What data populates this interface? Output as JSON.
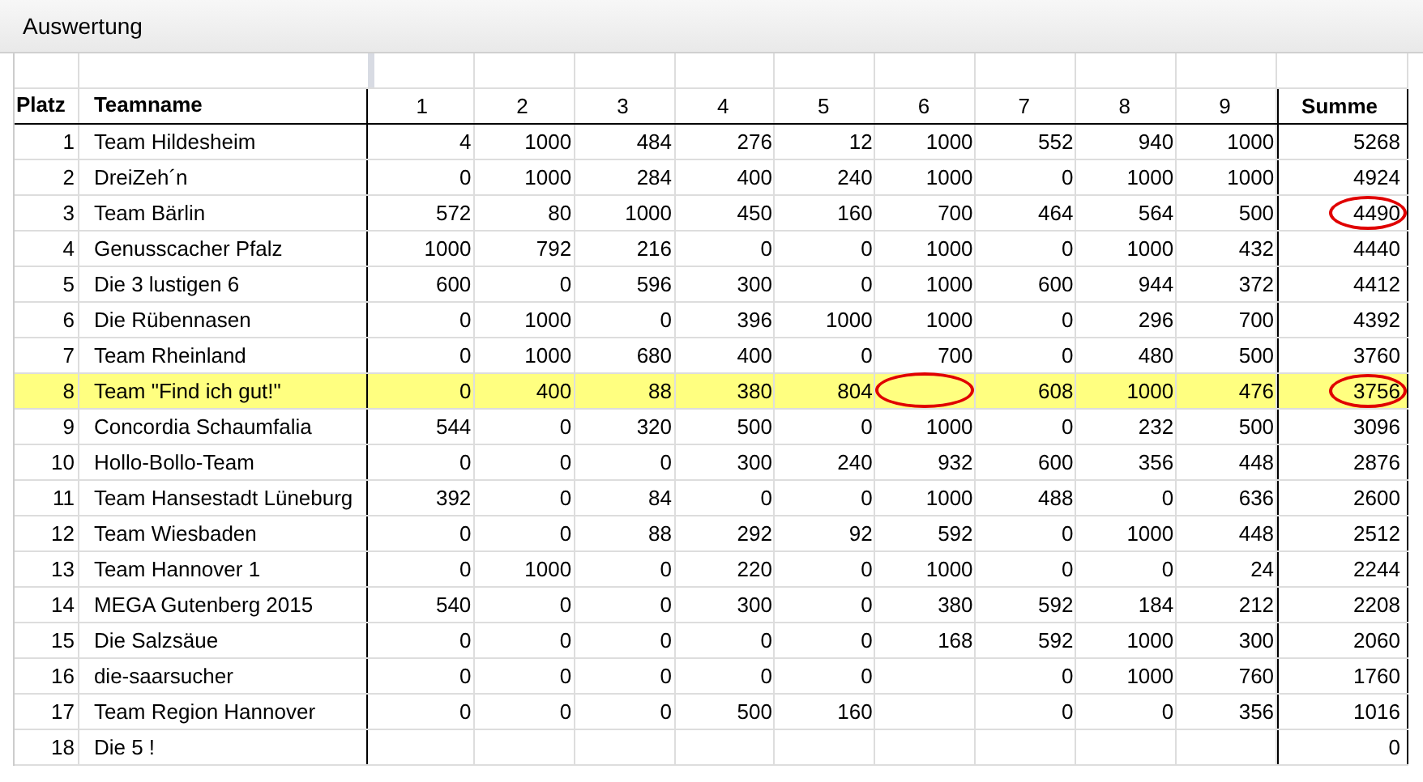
{
  "window": {
    "title": "Auswertung"
  },
  "table": {
    "columns": [
      "Platz",
      "Teamname",
      "1",
      "2",
      "3",
      "4",
      "5",
      "6",
      "7",
      "8",
      "9",
      "Summe"
    ],
    "rows": [
      {
        "rank": "1",
        "name": "Team Hildesheim",
        "highlighted": false,
        "scores": [
          {
            "value": "4",
            "circled": false
          },
          {
            "value": "1000",
            "circled": false
          },
          {
            "value": "484",
            "circled": false
          },
          {
            "value": "276",
            "circled": false
          },
          {
            "value": "12",
            "circled": false
          },
          {
            "value": "1000",
            "circled": false
          },
          {
            "value": "552",
            "circled": false
          },
          {
            "value": "940",
            "circled": false
          },
          {
            "value": "1000",
            "circled": false
          }
        ],
        "total": {
          "value": "5268",
          "circled": false
        }
      },
      {
        "rank": "2",
        "name": "DreiZeh´n",
        "highlighted": false,
        "scores": [
          {
            "value": "0",
            "circled": false
          },
          {
            "value": "1000",
            "circled": false
          },
          {
            "value": "284",
            "circled": false
          },
          {
            "value": "400",
            "circled": false
          },
          {
            "value": "240",
            "circled": false
          },
          {
            "value": "1000",
            "circled": false
          },
          {
            "value": "0",
            "circled": false
          },
          {
            "value": "1000",
            "circled": false
          },
          {
            "value": "1000",
            "circled": false
          }
        ],
        "total": {
          "value": "4924",
          "circled": false
        }
      },
      {
        "rank": "3",
        "name": "Team Bärlin",
        "highlighted": false,
        "scores": [
          {
            "value": "572",
            "circled": false
          },
          {
            "value": "80",
            "circled": false
          },
          {
            "value": "1000",
            "circled": false
          },
          {
            "value": "450",
            "circled": false
          },
          {
            "value": "160",
            "circled": false
          },
          {
            "value": "700",
            "circled": false
          },
          {
            "value": "464",
            "circled": false
          },
          {
            "value": "564",
            "circled": false
          },
          {
            "value": "500",
            "circled": false
          }
        ],
        "total": {
          "value": "4490",
          "circled": true
        }
      },
      {
        "rank": "4",
        "name": "Genusscacher Pfalz",
        "highlighted": false,
        "scores": [
          {
            "value": "1000",
            "circled": false
          },
          {
            "value": "792",
            "circled": false
          },
          {
            "value": "216",
            "circled": false
          },
          {
            "value": "0",
            "circled": false
          },
          {
            "value": "0",
            "circled": false
          },
          {
            "value": "1000",
            "circled": false
          },
          {
            "value": "0",
            "circled": false
          },
          {
            "value": "1000",
            "circled": false
          },
          {
            "value": "432",
            "circled": false
          }
        ],
        "total": {
          "value": "4440",
          "circled": false
        }
      },
      {
        "rank": "5",
        "name": "Die 3 lustigen 6",
        "highlighted": false,
        "scores": [
          {
            "value": "600",
            "circled": false
          },
          {
            "value": "0",
            "circled": false
          },
          {
            "value": "596",
            "circled": false
          },
          {
            "value": "300",
            "circled": false
          },
          {
            "value": "0",
            "circled": false
          },
          {
            "value": "1000",
            "circled": false
          },
          {
            "value": "600",
            "circled": false
          },
          {
            "value": "944",
            "circled": false
          },
          {
            "value": "372",
            "circled": false
          }
        ],
        "total": {
          "value": "4412",
          "circled": false
        }
      },
      {
        "rank": "6",
        "name": "Die Rübennasen",
        "highlighted": false,
        "scores": [
          {
            "value": "0",
            "circled": false
          },
          {
            "value": "1000",
            "circled": false
          },
          {
            "value": "0",
            "circled": false
          },
          {
            "value": "396",
            "circled": false
          },
          {
            "value": "1000",
            "circled": false
          },
          {
            "value": "1000",
            "circled": false
          },
          {
            "value": "0",
            "circled": false
          },
          {
            "value": "296",
            "circled": false
          },
          {
            "value": "700",
            "circled": false
          }
        ],
        "total": {
          "value": "4392",
          "circled": false
        }
      },
      {
        "rank": "7",
        "name": "Team Rheinland",
        "highlighted": false,
        "scores": [
          {
            "value": "0",
            "circled": false
          },
          {
            "value": "1000",
            "circled": false
          },
          {
            "value": "680",
            "circled": false
          },
          {
            "value": "400",
            "circled": false
          },
          {
            "value": "0",
            "circled": false
          },
          {
            "value": "700",
            "circled": false
          },
          {
            "value": "0",
            "circled": false
          },
          {
            "value": "480",
            "circled": false
          },
          {
            "value": "500",
            "circled": false
          }
        ],
        "total": {
          "value": "3760",
          "circled": false
        }
      },
      {
        "rank": "8",
        "name": "Team \"Find ich gut!\"",
        "highlighted": true,
        "scores": [
          {
            "value": "0",
            "circled": false
          },
          {
            "value": "400",
            "circled": false
          },
          {
            "value": "88",
            "circled": false
          },
          {
            "value": "380",
            "circled": false
          },
          {
            "value": "804",
            "circled": false
          },
          {
            "circled": true
          },
          {
            "value": "608",
            "circled": false
          },
          {
            "value": "1000",
            "circled": false
          },
          {
            "value": "476",
            "circled": false
          }
        ],
        "total": {
          "value": "3756",
          "circled": true
        }
      },
      {
        "rank": "9",
        "name": "Concordia Schaumfalia",
        "highlighted": false,
        "scores": [
          {
            "value": "544",
            "circled": false
          },
          {
            "value": "0",
            "circled": false
          },
          {
            "value": "320",
            "circled": false
          },
          {
            "value": "500",
            "circled": false
          },
          {
            "value": "0",
            "circled": false
          },
          {
            "value": "1000",
            "circled": false
          },
          {
            "value": "0",
            "circled": false
          },
          {
            "value": "232",
            "circled": false
          },
          {
            "value": "500",
            "circled": false
          }
        ],
        "total": {
          "value": "3096",
          "circled": false
        }
      },
      {
        "rank": "10",
        "name": "Hollo-Bollo-Team",
        "highlighted": false,
        "scores": [
          {
            "value": "0",
            "circled": false
          },
          {
            "value": "0",
            "circled": false
          },
          {
            "value": "0",
            "circled": false
          },
          {
            "value": "300",
            "circled": false
          },
          {
            "value": "240",
            "circled": false
          },
          {
            "value": "932",
            "circled": false
          },
          {
            "value": "600",
            "circled": false
          },
          {
            "value": "356",
            "circled": false
          },
          {
            "value": "448",
            "circled": false
          }
        ],
        "total": {
          "value": "2876",
          "circled": false
        }
      },
      {
        "rank": "11",
        "name": "Team Hansestadt Lüneburg",
        "highlighted": false,
        "scores": [
          {
            "value": "392",
            "circled": false
          },
          {
            "value": "0",
            "circled": false
          },
          {
            "value": "84",
            "circled": false
          },
          {
            "value": "0",
            "circled": false
          },
          {
            "value": "0",
            "circled": false
          },
          {
            "value": "1000",
            "circled": false
          },
          {
            "value": "488",
            "circled": false
          },
          {
            "value": "0",
            "circled": false
          },
          {
            "value": "636",
            "circled": false
          }
        ],
        "total": {
          "value": "2600",
          "circled": false
        }
      },
      {
        "rank": "12",
        "name": "Team Wiesbaden",
        "highlighted": false,
        "scores": [
          {
            "value": "0",
            "circled": false
          },
          {
            "value": "0",
            "circled": false
          },
          {
            "value": "88",
            "circled": false
          },
          {
            "value": "292",
            "circled": false
          },
          {
            "value": "92",
            "circled": false
          },
          {
            "value": "592",
            "circled": false
          },
          {
            "value": "0",
            "circled": false
          },
          {
            "value": "1000",
            "circled": false
          },
          {
            "value": "448",
            "circled": false
          }
        ],
        "total": {
          "value": "2512",
          "circled": false
        }
      },
      {
        "rank": "13",
        "name": "Team Hannover 1",
        "highlighted": false,
        "scores": [
          {
            "value": "0",
            "circled": false
          },
          {
            "value": "1000",
            "circled": false
          },
          {
            "value": "0",
            "circled": false
          },
          {
            "value": "220",
            "circled": false
          },
          {
            "value": "0",
            "circled": false
          },
          {
            "value": "1000",
            "circled": false
          },
          {
            "value": "0",
            "circled": false
          },
          {
            "value": "0",
            "circled": false
          },
          {
            "value": "24",
            "circled": false
          }
        ],
        "total": {
          "value": "2244",
          "circled": false
        }
      },
      {
        "rank": "14",
        "name": "MEGA Gutenberg 2015",
        "highlighted": false,
        "scores": [
          {
            "value": "540",
            "circled": false
          },
          {
            "value": "0",
            "circled": false
          },
          {
            "value": "0",
            "circled": false
          },
          {
            "value": "300",
            "circled": false
          },
          {
            "value": "0",
            "circled": false
          },
          {
            "value": "380",
            "circled": false
          },
          {
            "value": "592",
            "circled": false
          },
          {
            "value": "184",
            "circled": false
          },
          {
            "value": "212",
            "circled": false
          }
        ],
        "total": {
          "value": "2208",
          "circled": false
        }
      },
      {
        "rank": "15",
        "name": "Die Salzsäue",
        "highlighted": false,
        "scores": [
          {
            "value": "0",
            "circled": false
          },
          {
            "value": "0",
            "circled": false
          },
          {
            "value": "0",
            "circled": false
          },
          {
            "value": "0",
            "circled": false
          },
          {
            "value": "0",
            "circled": false
          },
          {
            "value": "168",
            "circled": false
          },
          {
            "value": "592",
            "circled": false
          },
          {
            "value": "1000",
            "circled": false
          },
          {
            "value": "300",
            "circled": false
          }
        ],
        "total": {
          "value": "2060",
          "circled": false
        }
      },
      {
        "rank": "16",
        "name": "die-saarsucher",
        "highlighted": false,
        "scores": [
          {
            "value": "0",
            "circled": false
          },
          {
            "value": "0",
            "circled": false
          },
          {
            "value": "0",
            "circled": false
          },
          {
            "value": "0",
            "circled": false
          },
          {
            "value": "0",
            "circled": false
          },
          {
            "circled": false
          },
          {
            "value": "0",
            "circled": false
          },
          {
            "value": "1000",
            "circled": false
          },
          {
            "value": "760",
            "circled": false
          }
        ],
        "total": {
          "value": "1760",
          "circled": false
        }
      },
      {
        "rank": "17",
        "name": "Team Region Hannover",
        "highlighted": false,
        "scores": [
          {
            "value": "0",
            "circled": false
          },
          {
            "value": "0",
            "circled": false
          },
          {
            "value": "0",
            "circled": false
          },
          {
            "value": "500",
            "circled": false
          },
          {
            "value": "160",
            "circled": false
          },
          {
            "circled": false
          },
          {
            "value": "0",
            "circled": false
          },
          {
            "value": "0",
            "circled": false
          },
          {
            "value": "356",
            "circled": false
          }
        ],
        "total": {
          "value": "1016",
          "circled": false
        }
      },
      {
        "rank": "18",
        "name": "Die 5 !",
        "highlighted": false,
        "scores": [
          {
            "circled": false
          },
          {
            "circled": false
          },
          {
            "circled": false
          },
          {
            "circled": false
          },
          {
            "circled": false
          },
          {
            "circled": false
          },
          {
            "circled": false
          },
          {
            "circled": false
          },
          {
            "circled": false
          }
        ],
        "total": {
          "value": "0",
          "circled": false
        }
      }
    ]
  }
}
